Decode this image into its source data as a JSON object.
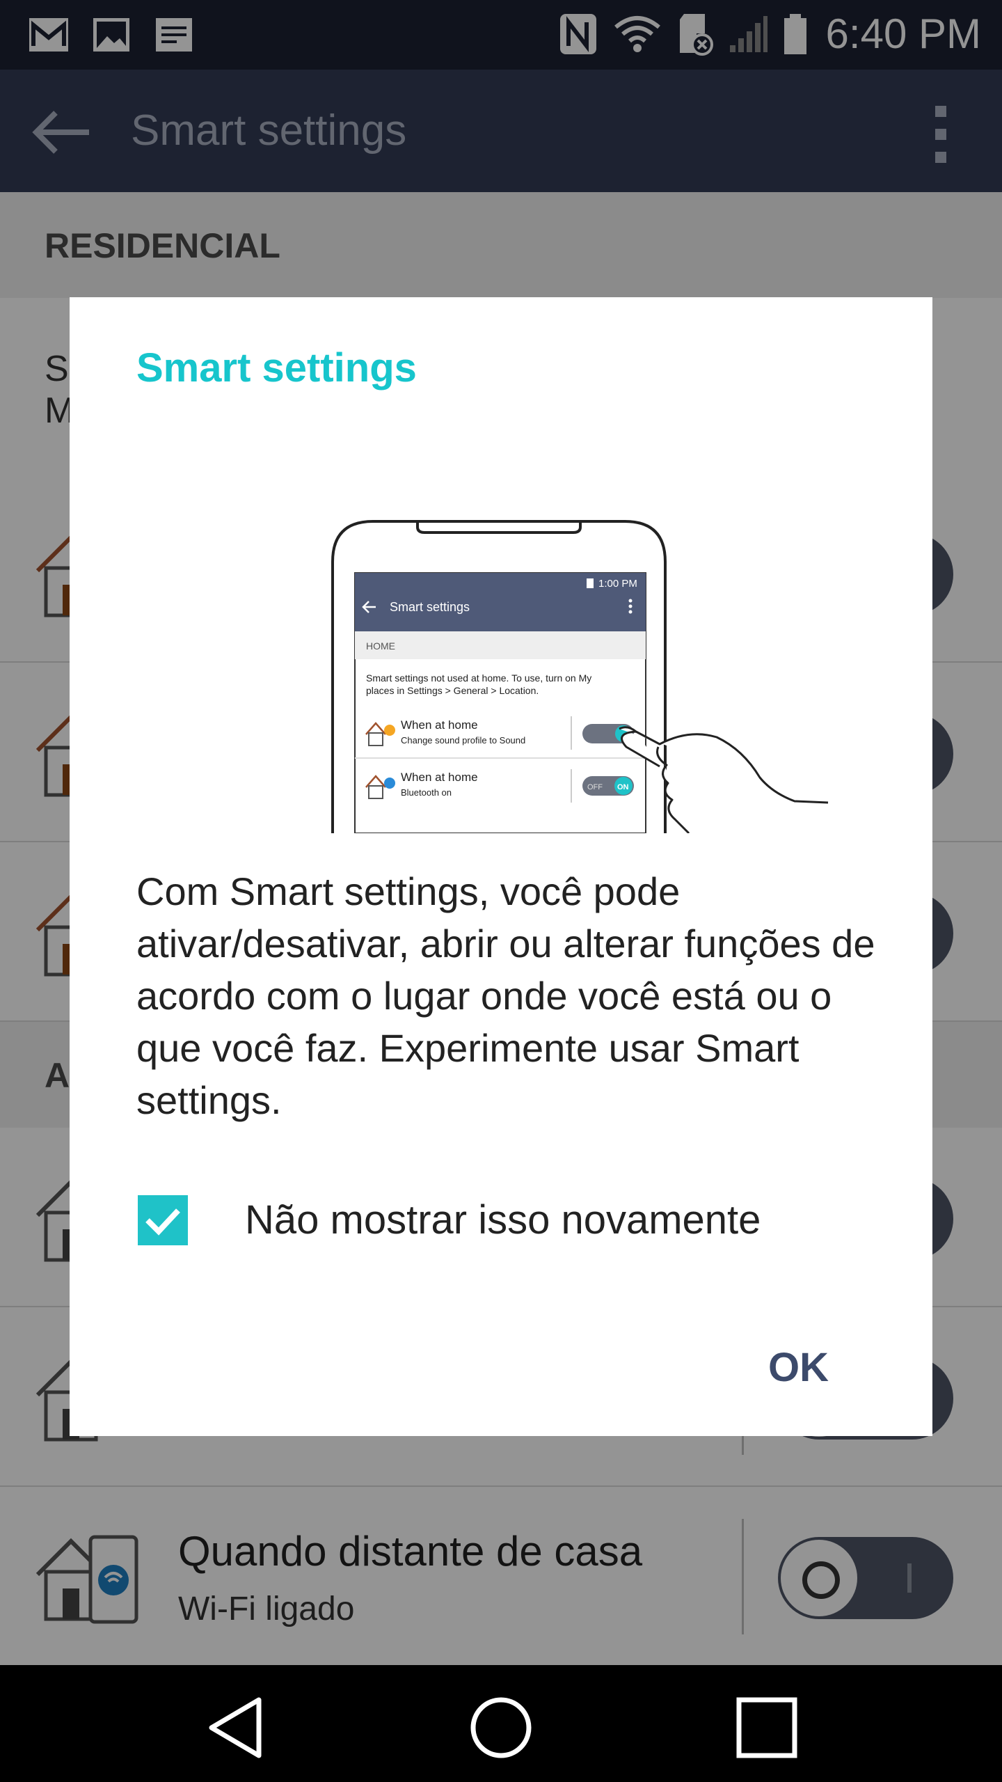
{
  "status_bar": {
    "time": "6:40 PM",
    "left_icons": [
      "gmail-icon",
      "gallery-icon",
      "notes-icon"
    ],
    "right_icons": [
      "nfc-icon",
      "wifi-icon",
      "sd-card-icon",
      "signal-icon",
      "battery-icon"
    ]
  },
  "app_bar": {
    "title": "Smart settings"
  },
  "list": {
    "section_residential": "RESIDENCIAL",
    "section_away_partial": "A",
    "desc_partial_1": "Sr",
    "desc_partial_2": "M",
    "last_row": {
      "title": "Quando distante de casa",
      "subtitle": "Wi-Fi ligado"
    }
  },
  "dialog": {
    "title": "Smart settings",
    "message": "Com Smart settings, você pode ativar/desativar, abrir ou alterar funções de acordo com o lugar onde você está ou o que você faz. Experimente usar Smart settings.",
    "checkbox_label": "Não mostrar isso novamente",
    "checkbox_checked": true,
    "ok_label": "OK",
    "illustration": {
      "time": "1:00 PM",
      "title": "Smart settings",
      "section": "HOME",
      "info": [
        "Smart settings not used at home. To use, turn on My",
        "places in Settings > General > Location."
      ],
      "item1_title": "When at home",
      "item1_sub": "Change sound profile to Sound",
      "item2_title": "When at home",
      "item2_sub": "Bluetooth on",
      "toggle_off": "OFF",
      "toggle_on": "ON"
    }
  },
  "colors": {
    "accent": "#17c5cc",
    "appbar": "#323b55",
    "statusbar": "#1c2233",
    "ok": "#3c4a6b"
  }
}
